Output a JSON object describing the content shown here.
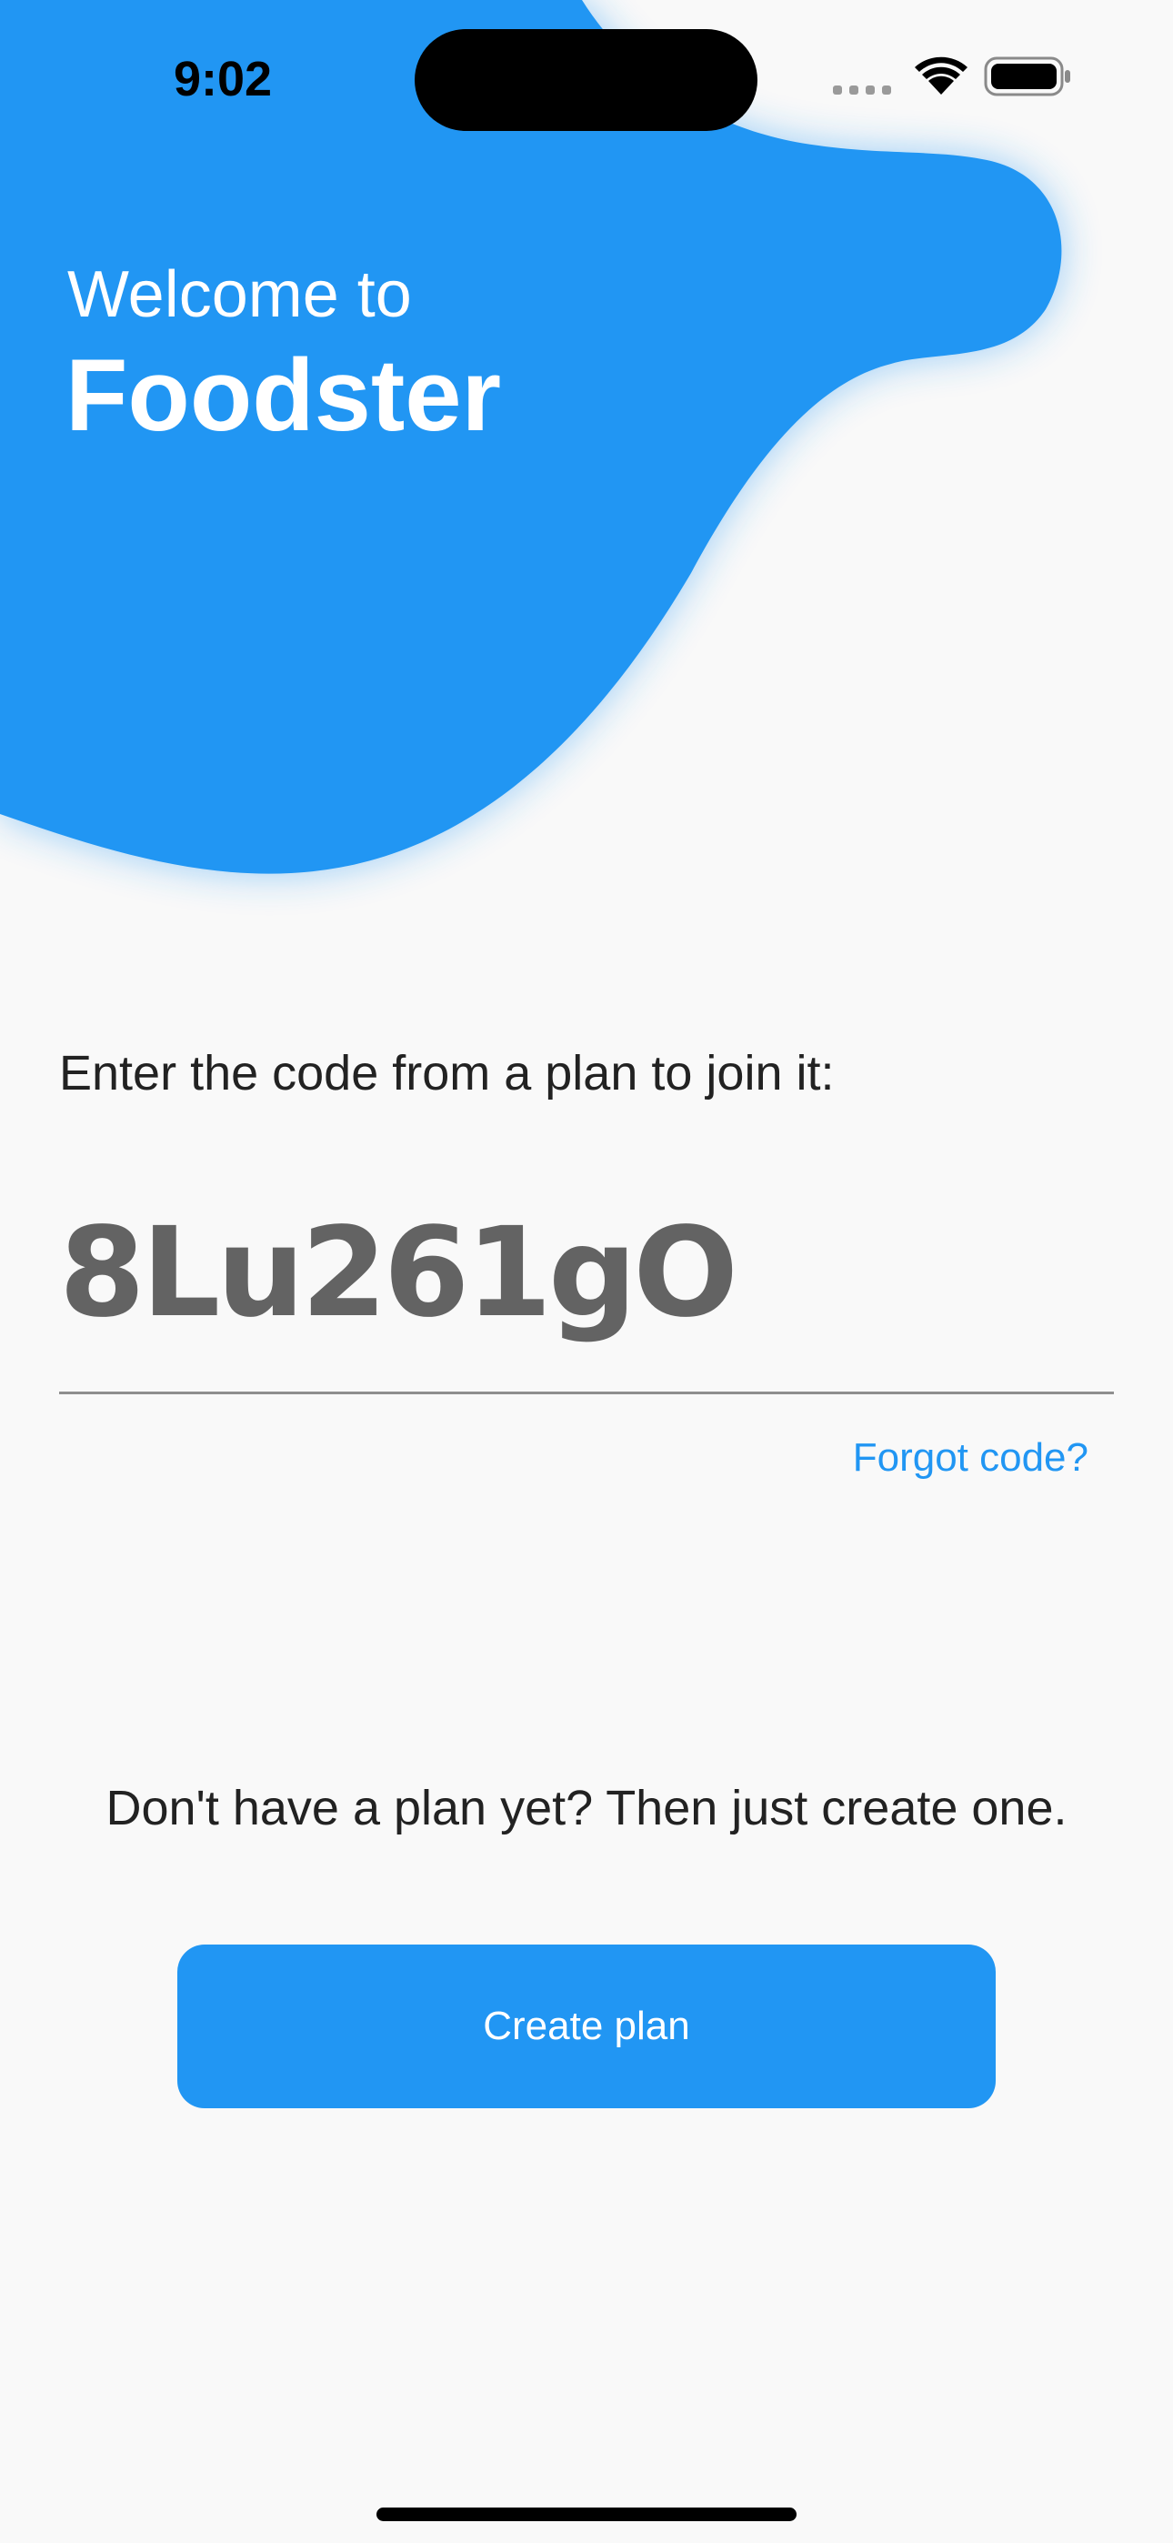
{
  "status_bar": {
    "time": "9:02",
    "icons": [
      "cellular-icon",
      "wifi-icon",
      "battery-icon"
    ]
  },
  "header": {
    "welcome": "Welcome to",
    "app_name": "Foodster"
  },
  "join": {
    "prompt": "Enter the code from a plan to join it:",
    "code_value": "8Lu261gO",
    "forgot_label": "Forgot code?"
  },
  "create": {
    "prompt": "Don't have a plan yet? Then just create one.",
    "button_label": "Create plan"
  },
  "colors": {
    "accent": "#2196f3",
    "background": "#f9f9f9",
    "code_text": "#636363",
    "body_text": "#222222"
  }
}
